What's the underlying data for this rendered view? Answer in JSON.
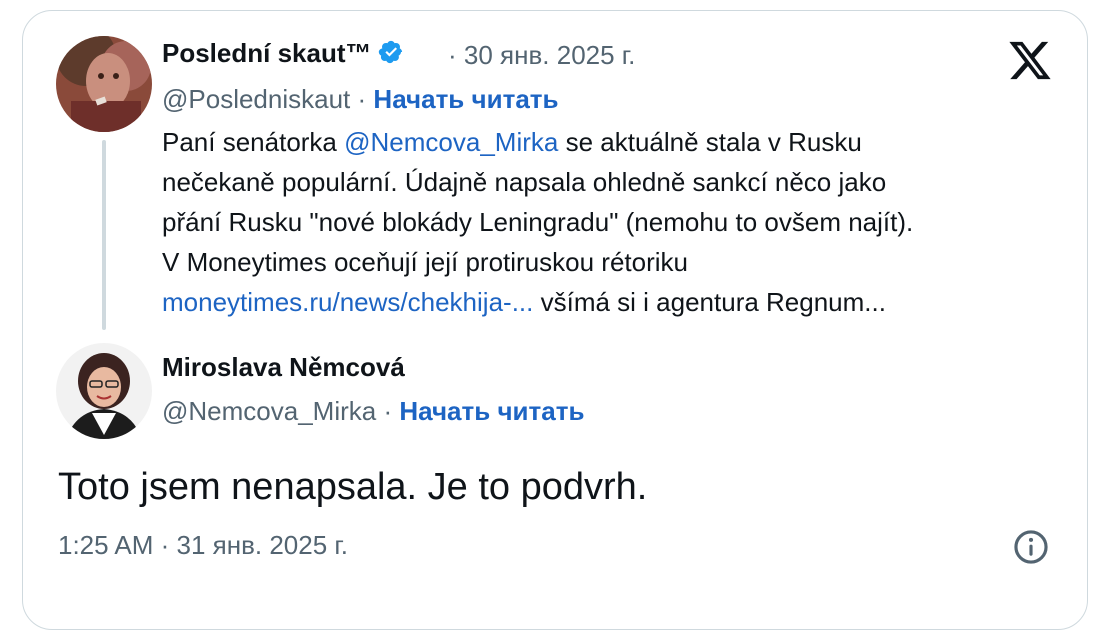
{
  "tweet1": {
    "name": "Poslední skaut™",
    "handle": "@Posledniskaut",
    "date": "30 янв. 2025 г.",
    "follow": "Начать читать",
    "separator": "·",
    "line1_a": "Paní senátorka ",
    "line1_mention": "@Nemcova_Mirka",
    "line1_b": " se aktuálně stala v Rusku",
    "line2": "nečekaně populární. Údajně napsala ohledně sankcí něco jako",
    "line3": "přání Rusku \"nové blokády Leningradu\" (nemohu to ovšem najít).",
    "line4": "V Moneytimes oceňují její protiruskou rétoriku",
    "line5_link": "moneytimes.ru/news/chekhija-...",
    "line5_b": " všímá si i agentura Regnum..."
  },
  "tweet2": {
    "name": "Miroslava Němcová",
    "handle": "@Nemcova_Mirka",
    "separator": "·",
    "follow": "Начать читать",
    "text": "Toto jsem nenapsala. Je to podvrh.",
    "time": "1:25 AM · 31 янв. 2025 г."
  },
  "icons": {
    "verified": "verified-badge-icon",
    "x_logo": "x-logo-icon",
    "info": "info-icon"
  },
  "colors": {
    "link": "#1d64c3",
    "verified": "#1d9bf0",
    "muted": "#536471",
    "text": "#0f1419",
    "border": "#cfd9de"
  }
}
